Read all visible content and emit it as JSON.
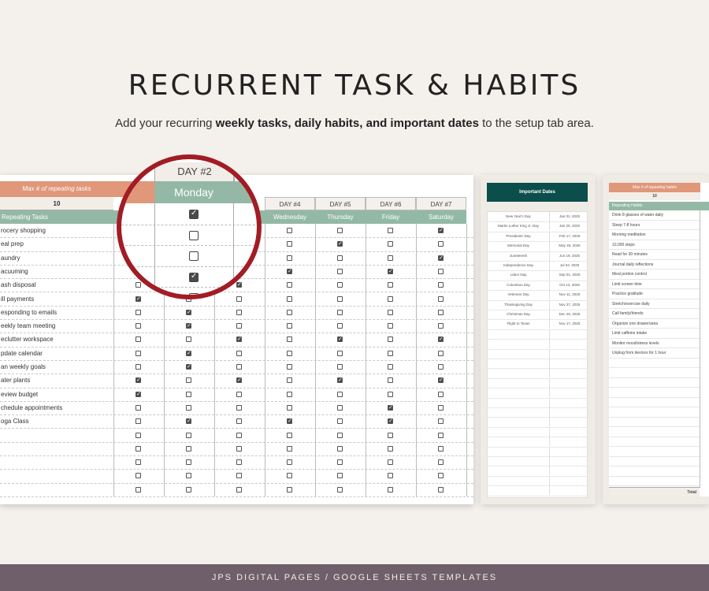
{
  "header": {
    "title": "RECURRENT TASK & HABITS",
    "subtitle_pre": "Add your recurring ",
    "subtitle_bold": "weekly tasks, daily habits, and important dates",
    "subtitle_post": " to the setup tab area."
  },
  "sheet": {
    "max_label": "Max # of repeating tasks",
    "max_value": "10",
    "tasks_header": "Repeating Tasks",
    "days": [
      {
        "num": "DAY #4",
        "name": "Wednesday"
      },
      {
        "num": "DAY #5",
        "name": "Thursday"
      },
      {
        "num": "DAY #6",
        "name": "Friday"
      },
      {
        "num": "DAY #7",
        "name": "Saturday"
      }
    ],
    "tasks": [
      "rocery shopping",
      "eal prep",
      "aundry",
      "acuuming",
      "ash disposal",
      "ill payments",
      "esponding to emails",
      "eekly team meeting",
      "eclutter workspace",
      "pdate calendar",
      "an weekly goals",
      "ater plants",
      "eview budget",
      "chedule appointments",
      "oga Class",
      "",
      "",
      "",
      "",
      ""
    ],
    "checks": [
      [
        0,
        0,
        0,
        0,
        0,
        0,
        1
      ],
      [
        0,
        0,
        0,
        0,
        1,
        0,
        0
      ],
      [
        0,
        0,
        0,
        0,
        0,
        0,
        1
      ],
      [
        0,
        0,
        0,
        1,
        0,
        1,
        0
      ],
      [
        0,
        0,
        1,
        0,
        0,
        0,
        0
      ],
      [
        1,
        0,
        0,
        0,
        0,
        0,
        0
      ],
      [
        0,
        1,
        0,
        0,
        0,
        0,
        0
      ],
      [
        0,
        1,
        0,
        0,
        0,
        0,
        0
      ],
      [
        0,
        0,
        1,
        0,
        1,
        0,
        1
      ],
      [
        0,
        1,
        0,
        0,
        0,
        0,
        0
      ],
      [
        0,
        1,
        0,
        0,
        0,
        0,
        0
      ],
      [
        1,
        0,
        1,
        0,
        1,
        0,
        1
      ],
      [
        1,
        0,
        0,
        0,
        0,
        0,
        0
      ],
      [
        0,
        0,
        0,
        0,
        0,
        1,
        0
      ],
      [
        0,
        1,
        0,
        1,
        0,
        1,
        0
      ],
      [
        0,
        0,
        0,
        0,
        0,
        0,
        0
      ],
      [
        0,
        0,
        0,
        0,
        0,
        0,
        0
      ],
      [
        0,
        0,
        0,
        0,
        0,
        0,
        0
      ],
      [
        0,
        0,
        0,
        0,
        0,
        0,
        0
      ],
      [
        0,
        0,
        0,
        0,
        0,
        0,
        0
      ]
    ]
  },
  "magnifier": {
    "day_num": "DAY #2",
    "day_name": "Monday",
    "checks": [
      1,
      0,
      0,
      1,
      0
    ]
  },
  "important_dates": {
    "title": "Important Dates",
    "rows": [
      {
        "name": "New Year's Day",
        "date": "Jan 01, 2025"
      },
      {
        "name": "Martin Luther King Jr. Day",
        "date": "Jan 20, 2025"
      },
      {
        "name": "Presidents' Day",
        "date": "Feb 17, 2025"
      },
      {
        "name": "Memorial Day",
        "date": "May 26, 2025"
      },
      {
        "name": "Juneteenth",
        "date": "Jun 19, 2025"
      },
      {
        "name": "Independence Day",
        "date": "Jul 04, 2025"
      },
      {
        "name": "Labor Day",
        "date": "Sep 01, 2025"
      },
      {
        "name": "Columbus Day",
        "date": "Oct 13, 2025"
      },
      {
        "name": "Veterans Day",
        "date": "Nov 11, 2025"
      },
      {
        "name": "Thanksgiving Day",
        "date": "Nov 27, 2025"
      },
      {
        "name": "Christmas Day",
        "date": "Dec 25, 2025"
      },
      {
        "name": "Flight to Texas",
        "date": "Nov 17, 2025"
      },
      {
        "name": "",
        "date": ""
      },
      {
        "name": "",
        "date": ""
      },
      {
        "name": "",
        "date": ""
      },
      {
        "name": "",
        "date": ""
      },
      {
        "name": "",
        "date": ""
      },
      {
        "name": "",
        "date": ""
      },
      {
        "name": "",
        "date": ""
      },
      {
        "name": "",
        "date": ""
      },
      {
        "name": "",
        "date": ""
      },
      {
        "name": "",
        "date": ""
      },
      {
        "name": "",
        "date": ""
      },
      {
        "name": "",
        "date": ""
      },
      {
        "name": "",
        "date": ""
      },
      {
        "name": "",
        "date": ""
      },
      {
        "name": "",
        "date": ""
      },
      {
        "name": "",
        "date": ""
      },
      {
        "name": "",
        "date": ""
      }
    ]
  },
  "habits": {
    "max_label": "Max # of repeating habits",
    "max_value": "10",
    "header": "Repeating Habits",
    "items": [
      "Drink 8 glasses of water daily",
      "Sleep 7-8 hours",
      "Morning meditation",
      "10,000 steps",
      "Read for 30 minutes",
      "Journal daily reflections",
      "Meal portion control",
      "Limit screen time",
      "Practice gratitude",
      "Stretch/exercise daily",
      "Call family/friends",
      "Organize one drawer/area",
      "Limit caffeine intake",
      "Monitor mood/stress levels",
      "Unplug from devices for 1 hour",
      "",
      "",
      "",
      "",
      "",
      "",
      "",
      "",
      "",
      "",
      "",
      "",
      ""
    ],
    "total_label": "Total"
  },
  "footer": {
    "text": "JPS DIGITAL PAGES / GOOGLE SHEETS TEMPLATES"
  }
}
